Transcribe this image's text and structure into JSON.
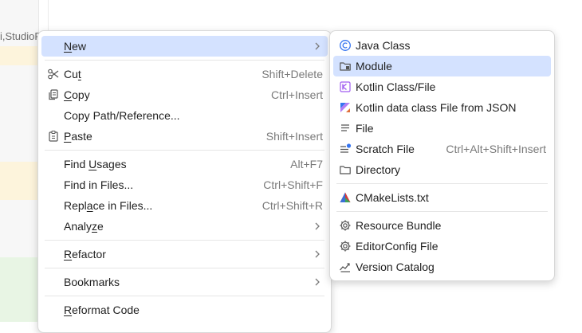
{
  "background": {
    "breadcrumb": "i,StudioP"
  },
  "main_menu": {
    "new": {
      "pre": "",
      "ul": "N",
      "post": "ew"
    },
    "cut": {
      "pre": "Cu",
      "ul": "t",
      "post": "",
      "shortcut": "Shift+Delete"
    },
    "copy": {
      "pre": "",
      "ul": "C",
      "post": "opy",
      "shortcut": "Ctrl+Insert"
    },
    "copy_path": {
      "label": "Copy Path/Reference..."
    },
    "paste": {
      "pre": "",
      "ul": "P",
      "post": "aste",
      "shortcut": "Shift+Insert"
    },
    "find_usages": {
      "pre": "Find ",
      "ul": "U",
      "post": "sages",
      "shortcut": "Alt+F7"
    },
    "find_in_files": {
      "label": "Find in Files...",
      "shortcut": "Ctrl+Shift+F"
    },
    "replace_in_files": {
      "pre": "Repl",
      "ul": "a",
      "post": "ce in Files...",
      "shortcut": "Ctrl+Shift+R"
    },
    "analyze": {
      "pre": "Analy",
      "ul": "z",
      "post": "e"
    },
    "refactor": {
      "pre": "",
      "ul": "R",
      "post": "efactor"
    },
    "bookmarks": {
      "label": "Bookmarks"
    },
    "reformat_code": {
      "pre": "",
      "ul": "R",
      "post": "eformat Code"
    }
  },
  "sub_menu": {
    "java_class": {
      "label": "Java Class"
    },
    "module": {
      "label": "Module"
    },
    "kotlin_class": {
      "label": "Kotlin Class/File"
    },
    "kotlin_json": {
      "label": "Kotlin data class File from JSON"
    },
    "file": {
      "label": "File"
    },
    "scratch_file": {
      "label": "Scratch File",
      "shortcut": "Ctrl+Alt+Shift+Insert"
    },
    "directory": {
      "label": "Directory"
    },
    "cmakelists": {
      "label": "CMakeLists.txt"
    },
    "resource_bundle": {
      "label": "Resource Bundle"
    },
    "editorconfig": {
      "label": "EditorConfig File"
    },
    "version_catalog": {
      "label": "Version Catalog"
    }
  },
  "colors": {
    "selection": "#d4e2ff",
    "java_icon": "#3574f0",
    "kotlin_icon": "#a05cf0",
    "cmake_icon": "#d33a3a"
  }
}
